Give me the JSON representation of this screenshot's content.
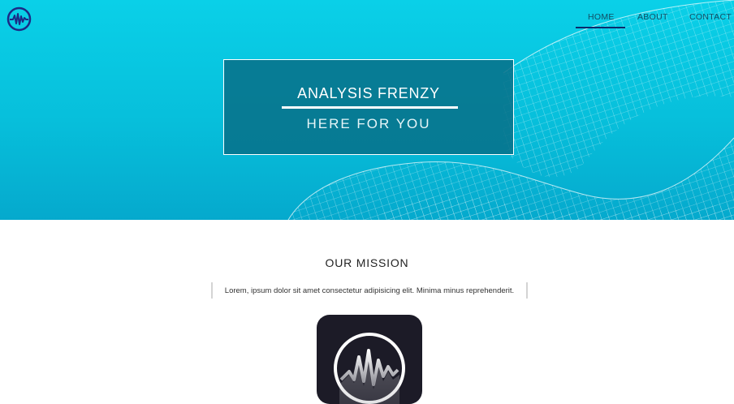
{
  "nav": {
    "items": [
      {
        "label": "HOME",
        "active": true
      },
      {
        "label": "ABOUT",
        "active": false
      },
      {
        "label": "CONTACT",
        "active": false
      }
    ],
    "active_color": "#0b2b6b"
  },
  "logo": {
    "icon": "pulse-wave-icon",
    "color": "#1b2a86"
  },
  "hero": {
    "title": "ANALYSIS FRENZY",
    "subtitle": "HERE FOR YOU",
    "background_color": "#07bfdb"
  },
  "mission": {
    "title": "OUR MISSION",
    "quote": "Lorem, ipsum dolor sit amet consectetur adipisicing elit. Minima minus reprehenderit."
  },
  "app_icon": {
    "icon": "pulse-wave-icon",
    "background_color": "#1c1b27"
  }
}
